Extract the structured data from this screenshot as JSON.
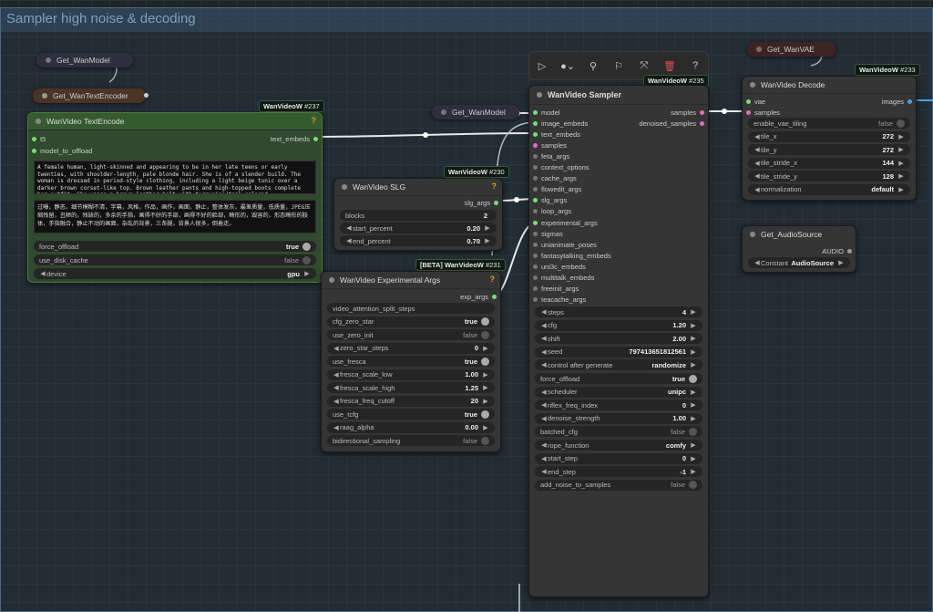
{
  "group": {
    "title": "Sampler high noise & decoding"
  },
  "toolbar": {
    "icons": [
      "play-icon",
      "circle-dropdown-icon",
      "wand-icon",
      "pin-icon",
      "collapse-icon",
      "trash-icon",
      "help-icon"
    ],
    "glyphs": [
      "▷",
      "●⌄",
      "⚲",
      "⚐",
      "⤧",
      "🗑",
      "?"
    ]
  },
  "get_wanmodel_top": {
    "label": "Get_WanModel"
  },
  "get_wantextencoder": {
    "label": "Get_WanTextEncoder"
  },
  "get_wanmodel_mid": {
    "label": "Get_WanModel"
  },
  "get_wanvae": {
    "label": "Get_WanVAE"
  },
  "textencode": {
    "badge": "WanVideoW",
    "badge_id": "#237",
    "title": "WanVideo TextEncode",
    "in_t5": "t5",
    "in_model_to_offload": "model_to_offload",
    "out_text_embeds": "text_embeds",
    "positive_prompt": "A female human, light-skinned and appearing to be in her late teens or early twenties, with shoulder-length, pale blonde hair. She is of a slender build. The woman is dressed in period-style clothing, including a light beige tunic over a darker brown corset-like top. Brown leather pants and high-topped boots complete her outfit. She wears a brown leather belt with turquoise/teal colored",
    "negative_prompt": "过曝，静态，细节模糊不清，字幕，风格，作品，画作，画面，静止，整体发灰，最差质量，低质量，JPEG压缩残留，丑陋的，残缺的，多余的手指，画得不好的手部，画得不好的脸部，畸形的，毁容的，形态畸形的肢体，手指融合，静止不动的画面，杂乱的背景，三条腿，背景人很多，倒着走。",
    "force_offload_label": "force_offload",
    "force_offload_value": "true",
    "use_disk_cache_label": "use_disk_cache",
    "use_disk_cache_value": "false",
    "device_label": "device",
    "device_value": "gpu"
  },
  "slg": {
    "badge": "WanVideoW",
    "badge_id": "#230",
    "title": "WanVideo SLG",
    "out": "slg_args",
    "blocks_label": "blocks",
    "blocks_value": "2",
    "start_label": "start_percent",
    "start_value": "0.20",
    "end_label": "end_percent",
    "end_value": "0.70"
  },
  "exp": {
    "badge": "[BETA] WanVideoW",
    "badge_id": "#231",
    "title": "WanVideo Experimental Args",
    "out": "exp_args",
    "rows": [
      {
        "label": "video_attention_split_steps",
        "value": "",
        "kind": "text"
      },
      {
        "label": "cfg_zero_star",
        "value": "true",
        "kind": "toggle"
      },
      {
        "label": "use_zero_init",
        "value": "false",
        "kind": "toggle"
      },
      {
        "label": "zero_star_steps",
        "value": "0",
        "kind": "num"
      },
      {
        "label": "use_fresca",
        "value": "true",
        "kind": "toggle"
      },
      {
        "label": "fresca_scale_low",
        "value": "1.00",
        "kind": "num"
      },
      {
        "label": "fresca_scale_high",
        "value": "1.25",
        "kind": "num"
      },
      {
        "label": "fresca_freq_cutoff",
        "value": "20",
        "kind": "num"
      },
      {
        "label": "use_tcfg",
        "value": "true",
        "kind": "toggle"
      },
      {
        "label": "raag_alpha",
        "value": "0.00",
        "kind": "num"
      },
      {
        "label": "bidirectional_sampling",
        "value": "false",
        "kind": "toggle"
      }
    ]
  },
  "sampler": {
    "badge": "WanVideoW",
    "badge_id": "#235",
    "title": "WanVideo Sampler",
    "inputs": [
      "model",
      "image_embeds",
      "text_embeds",
      "samples",
      "feta_args",
      "context_options",
      "cache_args",
      "flowedit_args",
      "slg_args",
      "loop_args",
      "experimental_args",
      "sigmas",
      "unianimate_poses",
      "fantasytalking_embeds",
      "uni3c_embeds",
      "multitalk_embeds",
      "freeinit_args",
      "teacache_args"
    ],
    "outputs": [
      "samples",
      "denoised_samples"
    ],
    "rows": [
      {
        "label": "steps",
        "value": "4",
        "kind": "num"
      },
      {
        "label": "cfg",
        "value": "1.20",
        "kind": "num"
      },
      {
        "label": "shift",
        "value": "2.00",
        "kind": "num"
      },
      {
        "label": "seed",
        "value": "797413651812561",
        "kind": "num"
      },
      {
        "label": "control after generate",
        "value": "randomize",
        "kind": "num"
      },
      {
        "label": "force_offload",
        "value": "true",
        "kind": "toggle"
      },
      {
        "label": "scheduler",
        "value": "unipc",
        "kind": "num"
      },
      {
        "label": "riflex_freq_index",
        "value": "0",
        "kind": "num"
      },
      {
        "label": "denoise_strength",
        "value": "1.00",
        "kind": "num"
      },
      {
        "label": "batched_cfg",
        "value": "false",
        "kind": "toggle"
      },
      {
        "label": "rope_function",
        "value": "comfy",
        "kind": "num"
      },
      {
        "label": "start_step",
        "value": "0",
        "kind": "num"
      },
      {
        "label": "end_step",
        "value": "-1",
        "kind": "num"
      },
      {
        "label": "add_noise_to_samples",
        "value": "false",
        "kind": "toggle"
      }
    ]
  },
  "decode": {
    "badge": "WanVideoW",
    "badge_id": "#233",
    "title": "WanVideo Decode",
    "in_vae": "vae",
    "in_samples": "samples",
    "out_images": "images",
    "rows": [
      {
        "label": "enable_vae_tiling",
        "value": "false",
        "kind": "toggle"
      },
      {
        "label": "tile_x",
        "value": "272",
        "kind": "num"
      },
      {
        "label": "tile_y",
        "value": "272",
        "kind": "num"
      },
      {
        "label": "tile_stride_x",
        "value": "144",
        "kind": "num"
      },
      {
        "label": "tile_stride_y",
        "value": "128",
        "kind": "num"
      },
      {
        "label": "normalization",
        "value": "default",
        "kind": "num"
      }
    ]
  },
  "audio": {
    "title": "Get_AudioSource",
    "out": "AUDIO",
    "constant_label": "Constant",
    "constant_value": "AudioSource"
  },
  "colors": {
    "accent_green": "#4d7a3c",
    "node_bg": "#353535",
    "wire": "#e8e8e8",
    "question": "#e0a020"
  }
}
